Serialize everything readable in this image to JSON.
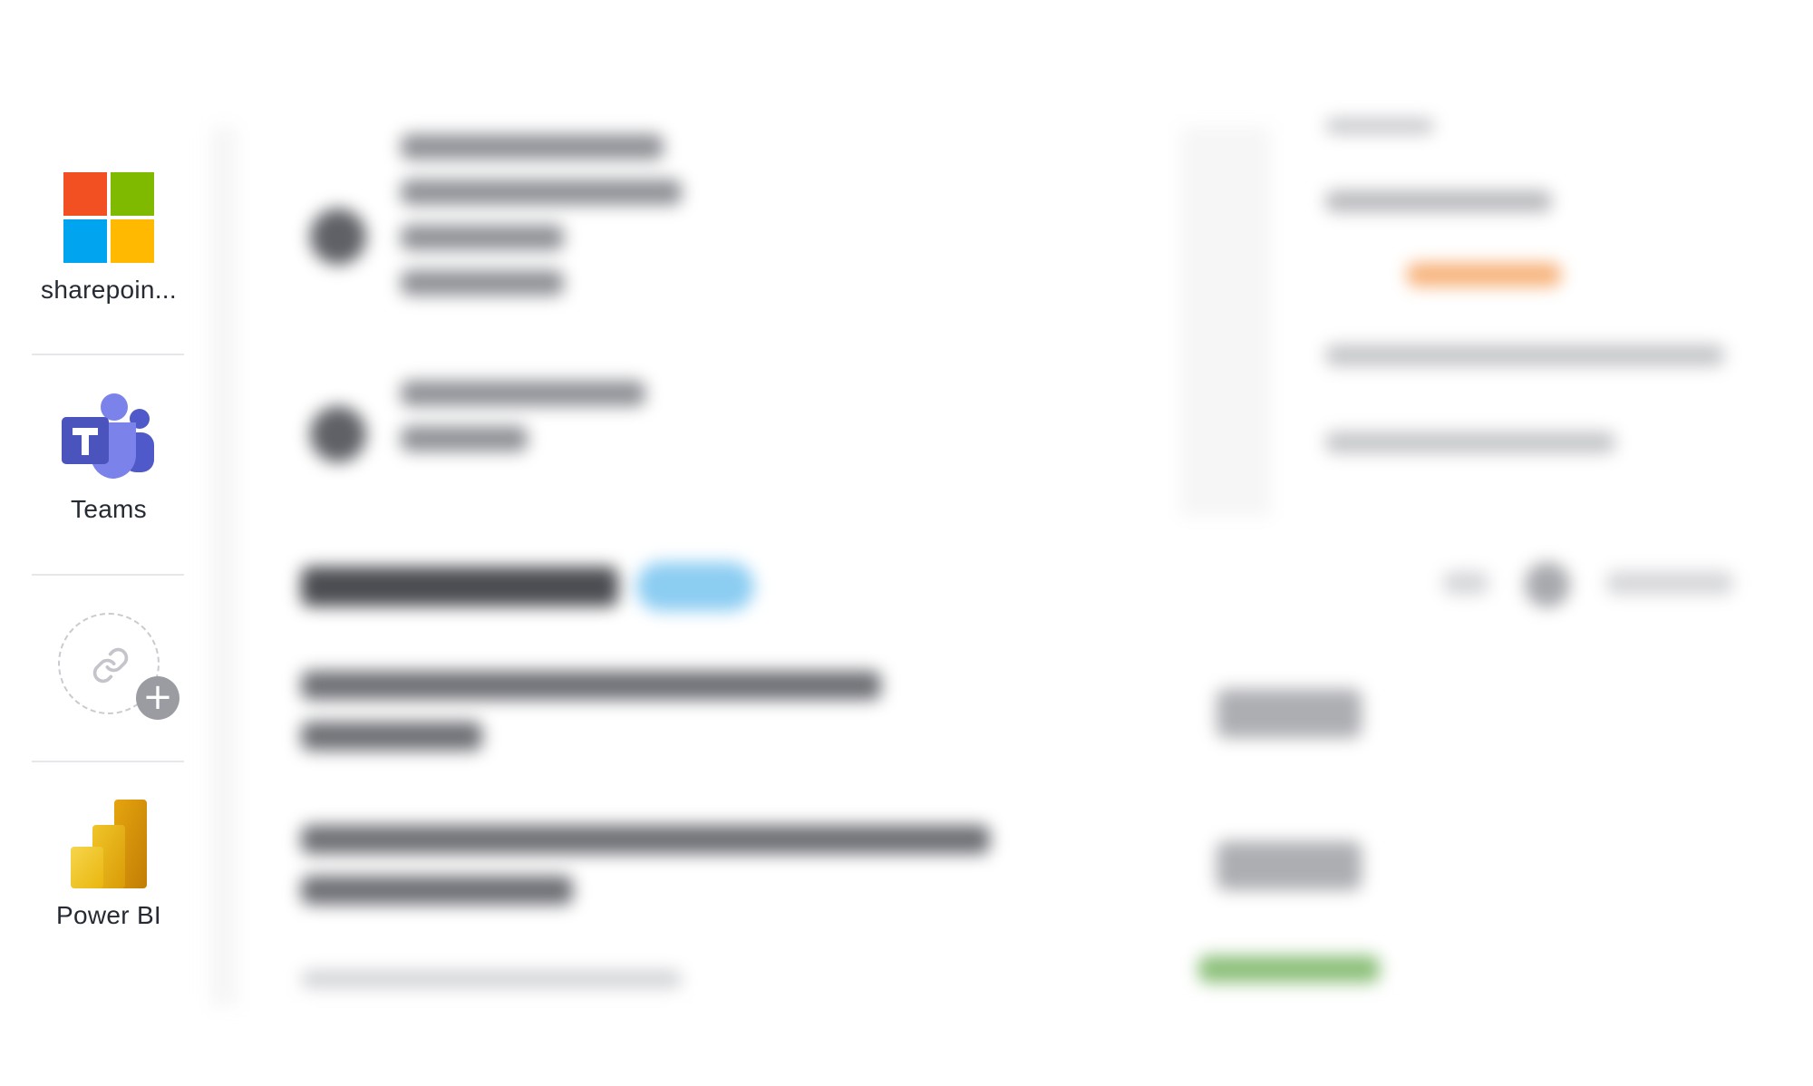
{
  "rail": {
    "apps": [
      {
        "label": "sharepoin...",
        "icon": "microsoft-logo-icon"
      },
      {
        "label": "Teams",
        "icon": "teams-logo-icon"
      },
      {
        "label": "",
        "icon": "link-icon"
      },
      {
        "label": "Power BI",
        "icon": "power-bi-logo-icon"
      }
    ]
  },
  "colors": {
    "ms_red": "#f25022",
    "ms_green": "#7fba00",
    "ms_blue": "#00a4ef",
    "ms_yellow": "#ffb900",
    "teams_purple": "#5059c9",
    "teams_violet": "#7b83eb",
    "pbi_gold": "#f2c811",
    "label_text": "#252a33"
  }
}
